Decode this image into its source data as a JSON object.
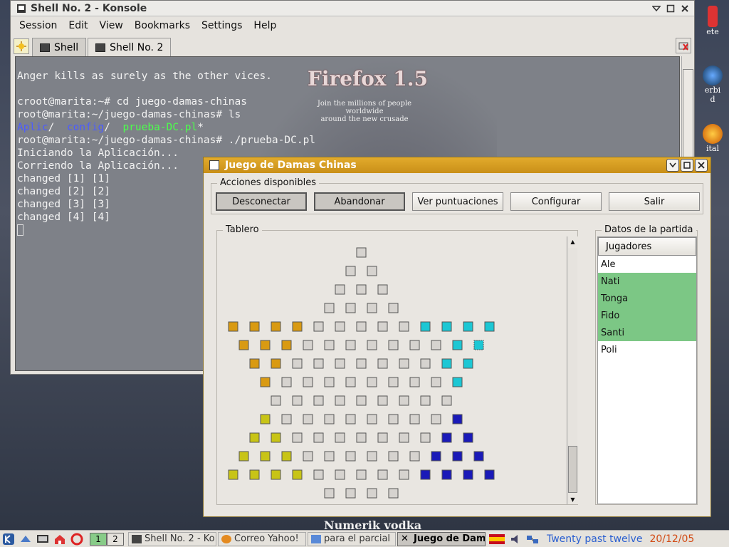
{
  "konsole": {
    "title": "Shell No. 2 - Konsole",
    "menu": [
      "Session",
      "Edit",
      "View",
      "Bookmarks",
      "Settings",
      "Help"
    ],
    "tabs": [
      "Shell",
      "Shell No. 2"
    ],
    "background": {
      "logo": "Firefox 1.5",
      "tagline_1": "Join the millions of people worldwide",
      "tagline_2": "around the new crusade"
    },
    "lines": [
      "Anger kills as surely as the other vices.",
      "",
      "croot@marita:~# cd juego-damas-chinas",
      "root@marita:~/juego-damas-chinas# ls",
      "__LS__",
      "root@marita:~/juego-damas-chinas# ./prueba-DC.pl",
      "Iniciando la Aplicación...",
      "Corriendo la Aplicación...",
      "changed [1] [1]",
      "changed [2] [2]",
      "changed [3] [3]",
      "changed [4] [4]"
    ],
    "ls_items": [
      {
        "name": "Aplic",
        "suffix": "/",
        "color": "blue"
      },
      {
        "name": "config",
        "suffix": "/",
        "color": "blue"
      },
      {
        "name": "prueba-DC.pl",
        "suffix": "*",
        "color": "green"
      }
    ]
  },
  "game": {
    "title": "Juego de Damas Chinas",
    "actions_title": "Acciones disponibles",
    "buttons": [
      "Desconectar",
      "Abandonar",
      "Ver puntuaciones",
      "Configurar",
      "Salir"
    ],
    "pressed_buttons": [
      "Desconectar",
      "Abandonar"
    ],
    "board_title": "Tablero",
    "match_title": "Datos de la partida",
    "players_header": "Jugadores",
    "players": [
      {
        "name": "Ale",
        "selected": false
      },
      {
        "name": "Nati",
        "selected": true
      },
      {
        "name": "Tonga",
        "selected": true
      },
      {
        "name": "Fido",
        "selected": true
      },
      {
        "name": "Santi",
        "selected": true
      },
      {
        "name": "Poli",
        "selected": false
      }
    ],
    "colors": {
      "orange": "#d99a12",
      "cyan": "#1cc7d4",
      "yellow": "#c8c416",
      "navy": "#1a1ab8",
      "empty": "#d6d3cf"
    },
    "board_rows": [
      "____e",
      "___e_e",
      "__e_e_e",
      "_e_e_e_e",
      "oooooeeeeecccc",
      "ooo eeeeeeecxc",
      " oo eeeeeeee cc",
      "  o eeeeeeeeec",
      "   eeeeeeeee",
      "  y eeeeeeeeen",
      " yy eeeeeeeeenn",
      "yyy eeeeeeeeennn",
      "yyyy eeeeeeeennnn",
      "_e_e_e_e"
    ]
  },
  "desktop": {
    "icon_labels": [
      "ete",
      "erbi\nd",
      "ital"
    ],
    "wallpaper_text": "Numerik vodka"
  },
  "taskbar": {
    "pager": [
      "1",
      "2"
    ],
    "tasks": [
      "Shell No. 2 - Ko",
      "Correo Yahoo!",
      "para el parcial",
      "Juego de Dam"
    ],
    "active_task": "Juego de Dam",
    "lang": "ES",
    "clock": "Twenty past twelve",
    "date": "20/12/05"
  }
}
